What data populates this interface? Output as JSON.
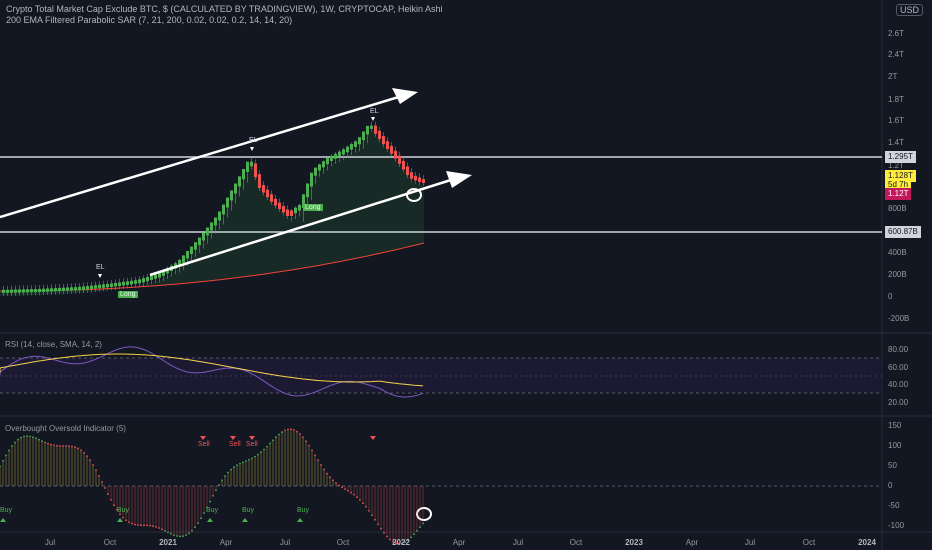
{
  "header": {
    "title": "Crypto Total Market Cap Exclude BTC, $ (CALCULATED BY TRADINGVIEW), 1W, CRYPTOCAP, Heikin Ashi",
    "indicator": "200 EMA Filtered Parabolic SAR (7, 21, 200, 0.02, 0.02, 0.2, 14, 14, 20)",
    "currency": "USD"
  },
  "price_axis": [
    "2.6T",
    "2.4T",
    "2T",
    "1.8T",
    "1.6T",
    "1.4T",
    "1.2T",
    "800B",
    "400B",
    "200B",
    "0",
    "-200B"
  ],
  "price_tags": {
    "level_upper": "1.295T",
    "current": "1.128T",
    "countdown": "5d 7h",
    "sar": "1.12T",
    "level_lower": "600.87B"
  },
  "markers": {
    "el_1": "EL",
    "el_2": "EL",
    "long_1": "Long",
    "long_2": "Long",
    "sell_1": "Sell",
    "sell_2": "Sell",
    "sell_3": "Sell",
    "buy_1": "Buy",
    "buy_2": "Buy",
    "buy_3": "Buy",
    "buy_4": "Buy",
    "buy_5": "Buy"
  },
  "rsi": {
    "label": "RSI (14, close, SMA, 14, 2)",
    "axis": [
      "80.00",
      "60.00",
      "40.00",
      "20.00"
    ]
  },
  "oscillator": {
    "label": "Overbought Oversold Indicator (5)",
    "axis": [
      "150",
      "100",
      "50",
      "0",
      "-50",
      "-100"
    ]
  },
  "time_axis": [
    "Jul",
    "Oct",
    "2021",
    "Apr",
    "Jul",
    "Oct",
    "2022",
    "Apr",
    "Jul",
    "Oct",
    "2023",
    "Apr",
    "Jul",
    "Oct",
    "2024"
  ],
  "colors": {
    "background": "#131722",
    "bull": "#26a69a",
    "bull_candle": "#4caf50",
    "bear_candle": "#ef5350",
    "rsi_line": "#7e57c2",
    "rsi_ma": "#f7d34b",
    "ema": "#f44336"
  }
}
